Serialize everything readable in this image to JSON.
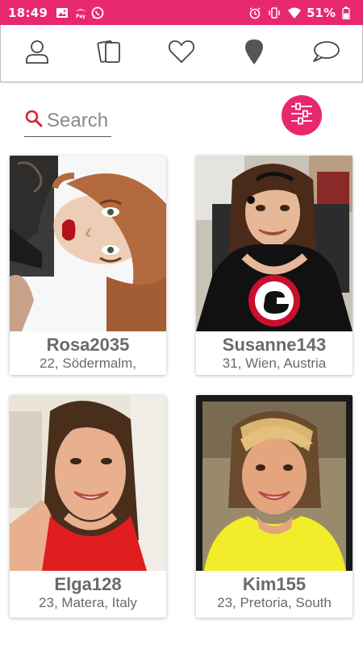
{
  "status_bar": {
    "time": "18:49",
    "battery": "51%",
    "left_icons": [
      "image-icon",
      "airplane-pay-icon",
      "whatsapp-icon"
    ],
    "right_icons": [
      "alarm-icon",
      "vibrate-icon",
      "wifi-icon",
      "battery-icon"
    ],
    "color": "#e8286e"
  },
  "nav": {
    "items": [
      {
        "name": "profile",
        "icon": "person-icon"
      },
      {
        "name": "cards",
        "icon": "cards-icon"
      },
      {
        "name": "favorites",
        "icon": "heart-icon"
      },
      {
        "name": "nearby",
        "icon": "location-pin-icon"
      },
      {
        "name": "messages",
        "icon": "chat-bubble-icon"
      }
    ]
  },
  "search": {
    "placeholder": "Search",
    "icon": "search-icon"
  },
  "filter": {
    "icon": "filter-sliders-icon",
    "color": "#e8286e"
  },
  "profiles": [
    {
      "name": "Rosa2035",
      "location": "22, Södermalm,"
    },
    {
      "name": "Susanne143",
      "location": "31, Wien, Austria"
    },
    {
      "name": "Elga128",
      "location": "23, Matera, Italy"
    },
    {
      "name": "Kim155",
      "location": "23, Pretoria, South"
    }
  ]
}
